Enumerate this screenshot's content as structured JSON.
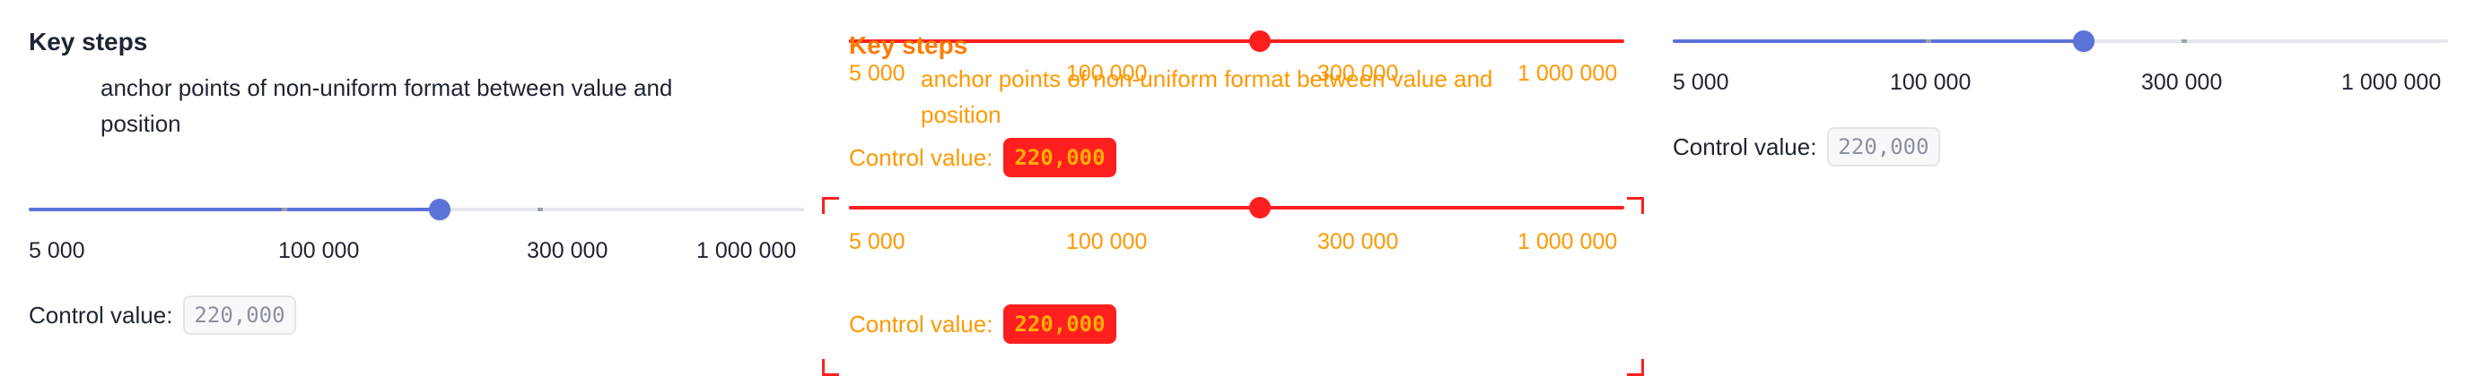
{
  "left": {
    "title": "Key steps",
    "description": "anchor points of non-uniform format between value and position",
    "slider": {
      "value_fraction": 0.53,
      "tick_fractions": [
        0.33,
        0.66
      ],
      "labels": [
        "5 000",
        "100 000",
        "300 000",
        "1 000 000"
      ]
    },
    "control_label": "Control value:",
    "control_value": "220,000"
  },
  "middle": {
    "title": "Key steps",
    "description": "anchor points of non-uniform format between value and position",
    "top_slider": {
      "value_fraction": 0.53,
      "labels": [
        "5 000",
        "100 000",
        "300 000",
        "1 000 000"
      ]
    },
    "bottom_slider": {
      "value_fraction": 0.53,
      "labels": [
        "5 000",
        "100 000",
        "300 000",
        "1 000 000"
      ]
    },
    "control_label": "Control value:",
    "control_value": "220,000"
  },
  "right": {
    "slider": {
      "value_fraction": 0.53,
      "tick_fractions": [
        0.33,
        0.66
      ],
      "labels": [
        "5 000",
        "100 000",
        "300 000",
        "1 000 000"
      ]
    },
    "control_label": "Control value:",
    "control_value": "220,000"
  },
  "colors": {
    "accent": "#5b72d9",
    "track": "#e5e7ec",
    "overlay_red": "#ff1f1f",
    "overlay_orange": "#ff9800"
  }
}
